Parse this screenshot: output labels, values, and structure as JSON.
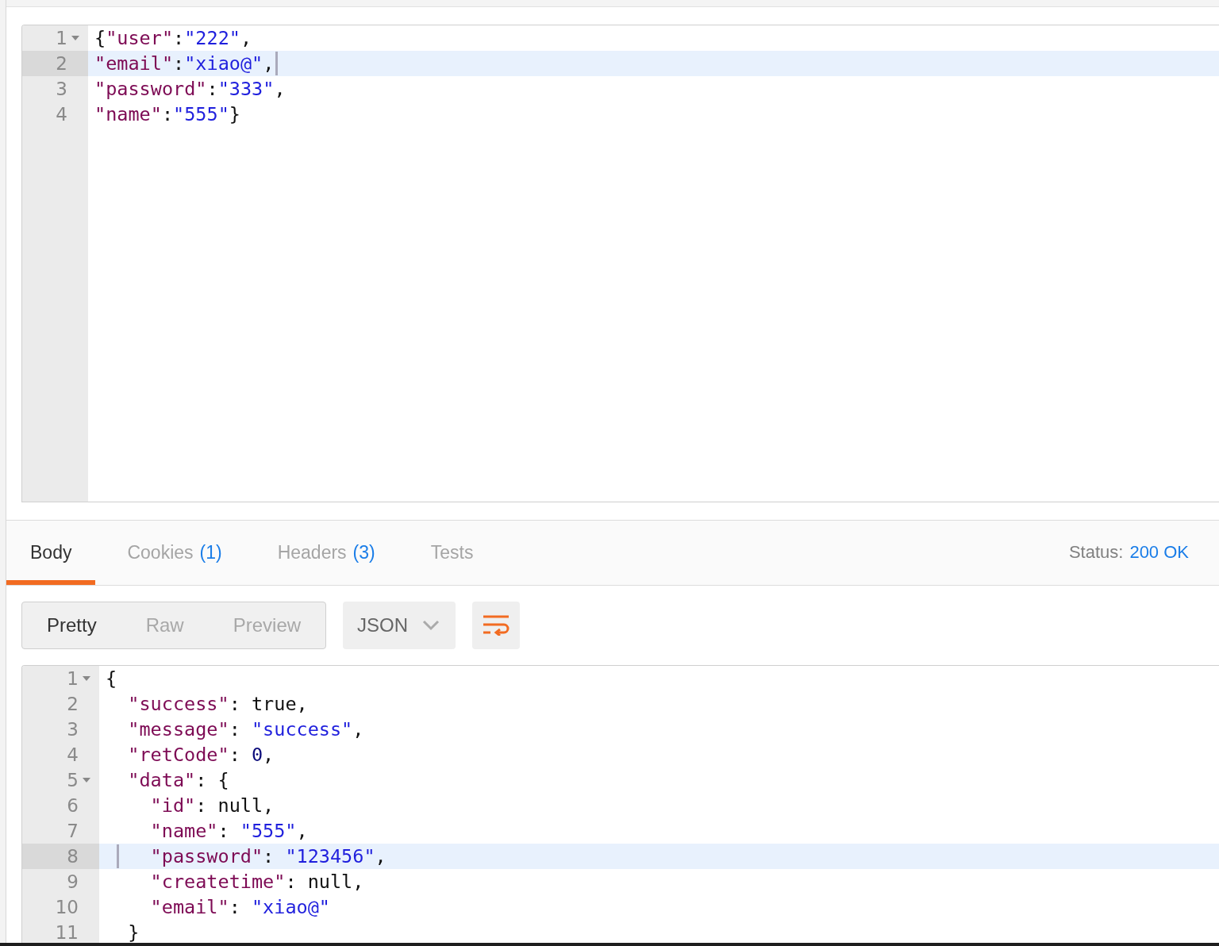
{
  "request_editor": {
    "lines": [
      {
        "number": "1",
        "fold": true,
        "active": false,
        "tokens": [
          {
            "kind": "plain",
            "text": "{"
          },
          {
            "kind": "key",
            "text": "\"user\""
          },
          {
            "kind": "plain",
            "text": ":"
          },
          {
            "kind": "string",
            "text": "\"222\""
          },
          {
            "kind": "plain",
            "text": ","
          }
        ]
      },
      {
        "number": "2",
        "fold": false,
        "active": true,
        "tokens": [
          {
            "kind": "key",
            "text": "\"email\""
          },
          {
            "kind": "plain",
            "text": ":"
          },
          {
            "kind": "string",
            "text": "\"xiao@\""
          },
          {
            "kind": "plain",
            "text": ","
          }
        ]
      },
      {
        "number": "3",
        "fold": false,
        "active": false,
        "tokens": [
          {
            "kind": "key",
            "text": "\"password\""
          },
          {
            "kind": "plain",
            "text": ":"
          },
          {
            "kind": "string",
            "text": "\"333\""
          },
          {
            "kind": "plain",
            "text": ","
          }
        ]
      },
      {
        "number": "4",
        "fold": false,
        "active": false,
        "tokens": [
          {
            "kind": "key",
            "text": "\"name\""
          },
          {
            "kind": "plain",
            "text": ":"
          },
          {
            "kind": "string",
            "text": "\"555\""
          },
          {
            "kind": "plain",
            "text": "}"
          }
        ]
      }
    ]
  },
  "response_tabs": [
    {
      "label": "Body",
      "selected": true
    },
    {
      "label": "Cookies",
      "count": "(1)",
      "selected": false
    },
    {
      "label": "Headers",
      "count": "(3)",
      "selected": false
    },
    {
      "label": "Tests",
      "selected": false
    }
  ],
  "status": {
    "label": "Status:",
    "value": "200 OK"
  },
  "view_modes": [
    {
      "label": "Pretty",
      "selected": true
    },
    {
      "label": "Raw",
      "selected": false
    },
    {
      "label": "Preview",
      "selected": false
    }
  ],
  "format_dropdown": {
    "value": "JSON"
  },
  "wrap_button": {
    "on": true
  },
  "response_editor": {
    "lines": [
      {
        "number": "1",
        "fold": true,
        "active": false,
        "tokens": [
          {
            "kind": "plain",
            "text": "{"
          }
        ]
      },
      {
        "number": "2",
        "fold": false,
        "active": false,
        "tokens": [
          {
            "kind": "key",
            "text": "  \"success\""
          },
          {
            "kind": "plain",
            "text": ": "
          },
          {
            "kind": "keyword",
            "text": "true"
          },
          {
            "kind": "plain",
            "text": ","
          }
        ]
      },
      {
        "number": "3",
        "fold": false,
        "active": false,
        "tokens": [
          {
            "kind": "key",
            "text": "  \"message\""
          },
          {
            "kind": "plain",
            "text": ": "
          },
          {
            "kind": "string",
            "text": "\"success\""
          },
          {
            "kind": "plain",
            "text": ","
          }
        ]
      },
      {
        "number": "4",
        "fold": false,
        "active": false,
        "tokens": [
          {
            "kind": "key",
            "text": "  \"retCode\""
          },
          {
            "kind": "plain",
            "text": ": "
          },
          {
            "kind": "number",
            "text": "0"
          },
          {
            "kind": "plain",
            "text": ","
          }
        ]
      },
      {
        "number": "5",
        "fold": true,
        "active": false,
        "tokens": [
          {
            "kind": "key",
            "text": "  \"data\""
          },
          {
            "kind": "plain",
            "text": ": {"
          }
        ]
      },
      {
        "number": "6",
        "fold": false,
        "active": false,
        "tokens": [
          {
            "kind": "key",
            "text": "    \"id\""
          },
          {
            "kind": "plain",
            "text": ": "
          },
          {
            "kind": "keyword",
            "text": "null"
          },
          {
            "kind": "plain",
            "text": ","
          }
        ]
      },
      {
        "number": "7",
        "fold": false,
        "active": false,
        "tokens": [
          {
            "kind": "key",
            "text": "    \"name\""
          },
          {
            "kind": "plain",
            "text": ": "
          },
          {
            "kind": "string",
            "text": "\"555\""
          },
          {
            "kind": "plain",
            "text": ","
          }
        ]
      },
      {
        "number": "8",
        "fold": false,
        "active": true,
        "tokens": [
          {
            "kind": "key",
            "text": "    \"password\""
          },
          {
            "kind": "plain",
            "text": ": "
          },
          {
            "kind": "string",
            "text": "\"123456\""
          },
          {
            "kind": "plain",
            "text": ","
          }
        ]
      },
      {
        "number": "9",
        "fold": false,
        "active": false,
        "tokens": [
          {
            "kind": "key",
            "text": "    \"createtime\""
          },
          {
            "kind": "plain",
            "text": ": "
          },
          {
            "kind": "keyword",
            "text": "null"
          },
          {
            "kind": "plain",
            "text": ","
          }
        ]
      },
      {
        "number": "10",
        "fold": false,
        "active": false,
        "tokens": [
          {
            "kind": "key",
            "text": "    \"email\""
          },
          {
            "kind": "plain",
            "text": ": "
          },
          {
            "kind": "string",
            "text": "\"xiao@\""
          }
        ]
      },
      {
        "number": "11",
        "fold": false,
        "active": false,
        "tokens": [
          {
            "kind": "plain",
            "text": "  }"
          }
        ]
      }
    ]
  }
}
